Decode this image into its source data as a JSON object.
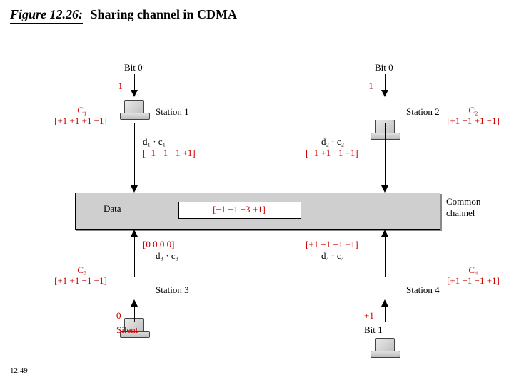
{
  "figure": {
    "number": "Figure 12.26:",
    "title": "Sharing channel in CDMA"
  },
  "page": "12.49",
  "channel": {
    "data_label": "Data",
    "data_value": "[−1 −1  −3  +1]",
    "common_label_top": "Common",
    "common_label_bot": "channel"
  },
  "stations": {
    "s1": {
      "name": "Station 1",
      "bit_label": "Bit 0",
      "bit_value": "−1",
      "code_name": "C₁",
      "code": "[+1 +1  +1  −1]",
      "prod_label": "d₁ · c₁",
      "prod": "[−1 −1  −1  +1]"
    },
    "s2": {
      "name": "Station 2",
      "bit_label": "Bit 0",
      "bit_value": "−1",
      "code_name": "C₂",
      "code": "[+1 −1  +1  −1]",
      "prod_label": "d₂ · c₂",
      "prod": "[−1 +1  −1  +1]"
    },
    "s3": {
      "name": "Station 3",
      "bit_label": "0",
      "bit_note": "Silent",
      "code_name": "C₃",
      "code": "[+1 +1  −1  −1]",
      "prod_label": "d₃ · c₃",
      "prod": "[0   0    0    0]"
    },
    "s4": {
      "name": "Station 4",
      "bit_label": "+1",
      "bit_note": "Bit 1",
      "code_name": "C₄",
      "code": "[+1 −1  −1  +1]",
      "prod_label": "d₄ · c₄",
      "prod": "[+1 −1  −1  +1]"
    }
  }
}
